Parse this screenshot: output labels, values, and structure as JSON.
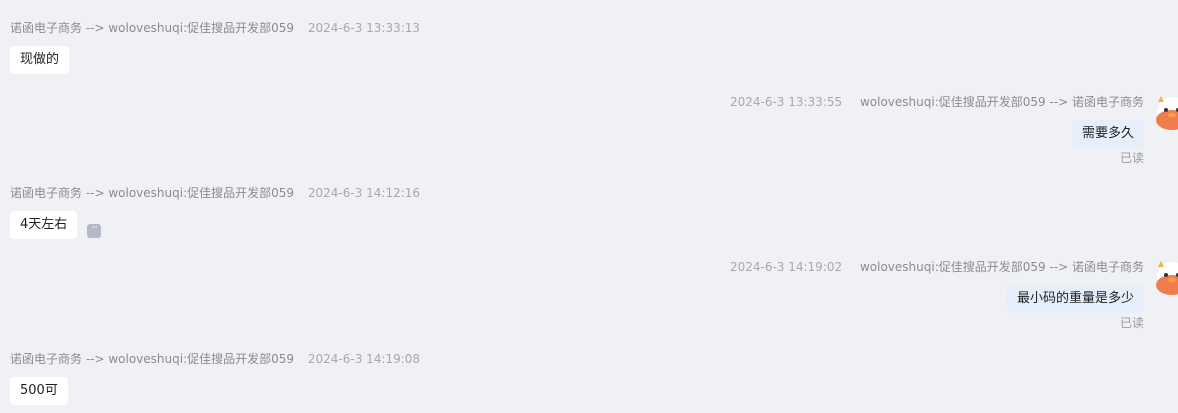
{
  "messages": [
    {
      "dir": "in",
      "sender": "诺函电子商务 --> woloveshuqi:促佳搜品开发部059",
      "time": "2024-6-3 13:33:13",
      "text": "现做的"
    },
    {
      "dir": "out",
      "sender": "woloveshuqi:促佳搜品开发部059 --> 诺函电子商务",
      "time": "2024-6-3 13:33:55",
      "text": "需要多久",
      "status": "已读"
    },
    {
      "dir": "in",
      "sender": "诺函电子商务 --> woloveshuqi:促佳搜品开发部059",
      "time": "2024-6-3 14:12:16",
      "text": "4天左右"
    },
    {
      "dir": "out",
      "sender": "woloveshuqi:促佳搜品开发部059 --> 诺函电子商务",
      "time": "2024-6-3 14:19:02",
      "text": "最小码的重量是多少",
      "status": "已读"
    },
    {
      "dir": "in",
      "sender": "诺函电子商务 --> woloveshuqi:促佳搜品开发部059",
      "time": "2024-6-3 14:19:08",
      "text": "500可"
    }
  ],
  "icons": {
    "more": "ellipsis-icon",
    "avatar": "cartoon-avatar"
  }
}
